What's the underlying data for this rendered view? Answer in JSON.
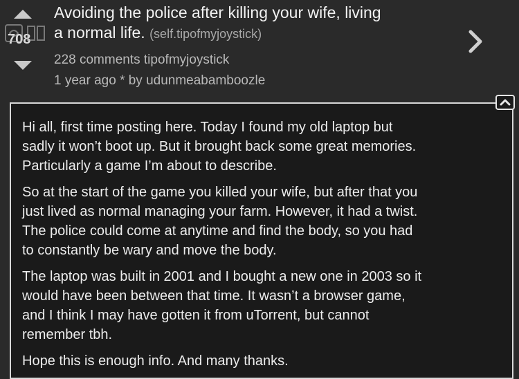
{
  "post": {
    "score": "708",
    "title": "Avoiding the police after killing your wife, living a normal life.",
    "title_line1": "Avoiding the police after killing your wife, living",
    "title_line2": "a normal life.",
    "domain": "(self.tipofmyjoystick)",
    "comments": "228 comments",
    "subreddit": "tipofmyjoystick",
    "age_author": "1 year ago * by udunmeabamboozle"
  },
  "body": {
    "paragraphs": [
      "Hi all, first time posting here. Today I found my old laptop but\nsadly it won’t boot up. But it brought back some great memories.\nParticularly a game I’m about to describe.",
      "So at the start of the game you killed your wife, but after that you\njust lived as normal managing your farm. However, it had a twist.\nThe police could come at anytime and find the body, so you had\nto constantly be wary and move the body.",
      "The laptop was built in 2001 and I bought a new one in 2003 so it\nwould have been between that time. It wasn’t a browser game,\nand I think I may have gotten it from uTorrent, but cannot\nremember tbh.",
      "Hope this is enough info. And many thanks."
    ]
  },
  "icons": {
    "upvote": "arrow-up-icon",
    "downvote": "arrow-down-icon",
    "open": "chevron-right-icon",
    "collapse": "chevron-up-icon",
    "watermark": "logo-icon"
  }
}
